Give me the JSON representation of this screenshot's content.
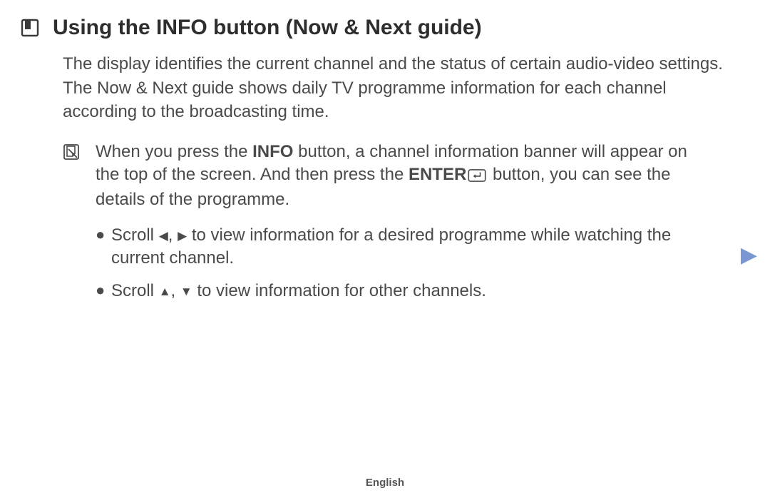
{
  "header": {
    "title": "Using the INFO button (Now & Next guide)"
  },
  "paragraphs": {
    "p1": "The display identifies the current channel and the status of certain audio-video settings.",
    "p2": "The Now & Next guide shows daily TV programme information for each channel according to the broadcasting time."
  },
  "note": {
    "pre": "When you press the ",
    "info_label": "INFO",
    "mid1": " button, a channel information banner will appear on the top of the screen. And then press the ",
    "enter_label": "ENTER",
    "post": " button, you can see the details of the programme."
  },
  "bullets": {
    "b1_pre": "Scroll ",
    "b1_post": " to view information for a desired programme while watching the current channel.",
    "b2_pre": "Scroll ",
    "b2_post": " to view information for other channels."
  },
  "glyphs": {
    "left": "◀",
    "right": "▶",
    "up": "▲",
    "down": "▼",
    "comma": ", ",
    "bullet": "●",
    "nav_next": "▶"
  },
  "footer": {
    "language": "English"
  }
}
